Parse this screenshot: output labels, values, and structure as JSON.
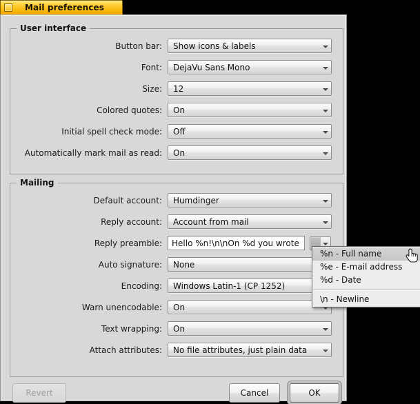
{
  "window": {
    "title": "Mail preferences",
    "close_box_icon": "close-box-icon"
  },
  "groups": {
    "user_interface": {
      "title": "User interface",
      "fields": [
        {
          "label": "Button bar:",
          "value": "Show icons & labels",
          "type": "menufield"
        },
        {
          "label": "Font:",
          "value": "DejaVu Sans Mono",
          "type": "menufield"
        },
        {
          "label": "Size:",
          "value": "12",
          "type": "menufield"
        },
        {
          "label": "Colored quotes:",
          "value": "On",
          "type": "menufield"
        },
        {
          "label": "Initial spell check mode:",
          "value": "Off",
          "type": "menufield"
        },
        {
          "label": "Automatically mark mail as read:",
          "value": "On",
          "type": "menufield"
        }
      ]
    },
    "mailing": {
      "title": "Mailing",
      "fields": [
        {
          "label": "Default account:",
          "value": "Humdinger",
          "type": "menufield"
        },
        {
          "label": "Reply account:",
          "value": "Account from mail",
          "type": "menufield"
        },
        {
          "label": "Reply preamble:",
          "value": "Hello %n!\\n\\nOn %d you wrote",
          "type": "textcontrol"
        },
        {
          "label": "Auto signature:",
          "value": "None",
          "type": "menufield"
        },
        {
          "label": "Encoding:",
          "value": "Windows Latin-1 (CP 1252)",
          "type": "menufield"
        },
        {
          "label": "Warn unencodable:",
          "value": "On",
          "type": "menufield"
        },
        {
          "label": "Text wrapping:",
          "value": "On",
          "type": "menufield"
        },
        {
          "label": "Attach attributes:",
          "value": "No file attributes, just plain data",
          "type": "menufield"
        }
      ]
    }
  },
  "popup_menu": {
    "items": [
      {
        "label": "%n - Full name",
        "selected": true
      },
      {
        "label": "%e - E-mail address",
        "selected": false
      },
      {
        "label": "%d - Date",
        "selected": false
      },
      {
        "label": "\\n - Newline",
        "selected": false
      }
    ],
    "separator_after_index": 2
  },
  "buttons": {
    "revert": "Revert",
    "cancel": "Cancel",
    "ok": "OK"
  },
  "colors": {
    "title_bar_yellow": "#ffd23c",
    "panel_gray": "#d8d8d8",
    "desktop_black": "#000000",
    "menu_gray": "#ededed"
  }
}
